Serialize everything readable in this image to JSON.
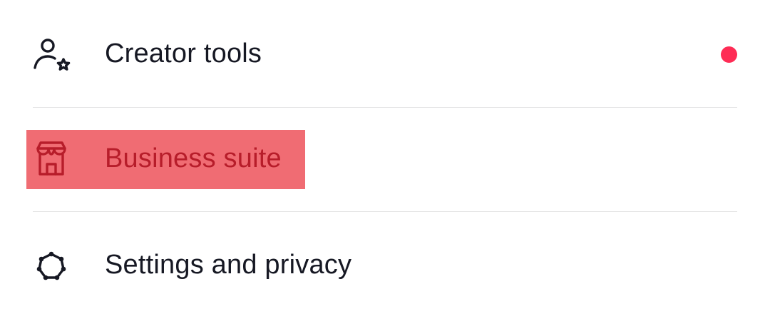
{
  "menu": {
    "items": [
      {
        "label": "Creator tools",
        "icon": "creator-tools-icon",
        "has_notification_dot": true
      },
      {
        "label": "Business suite",
        "icon": "storefront-icon",
        "highlighted": true
      },
      {
        "label": "Settings and privacy",
        "icon": "gear-icon"
      }
    ]
  },
  "colors": {
    "text": "#161823",
    "notification_dot": "#fe2c55",
    "highlight_fill": "#f06c73",
    "highlight_text": "#b71d2a",
    "divider": "#e3e3e4"
  }
}
